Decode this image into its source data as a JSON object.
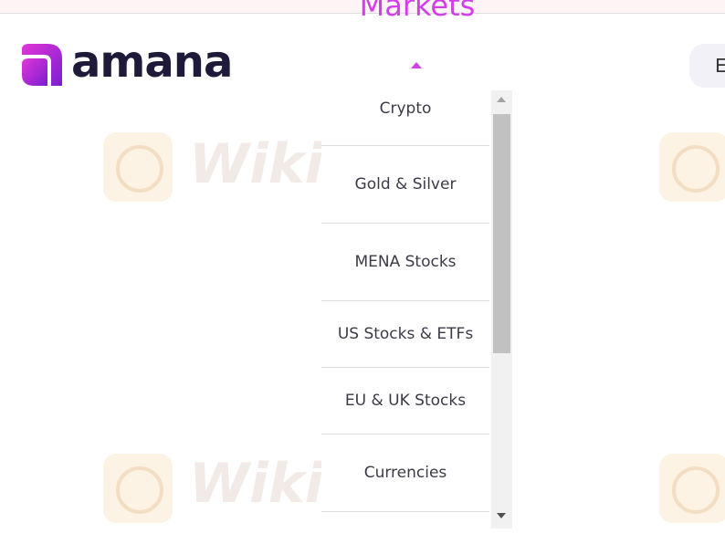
{
  "top_strip": {},
  "brand": {
    "name": "amana",
    "accent_color": "#d23fe8",
    "logo_gradient": [
      "#e235d8",
      "#7a1fd0"
    ],
    "text_color": "#1d1a3a"
  },
  "nav": {
    "active_title": "Markets"
  },
  "language": {
    "label": "E"
  },
  "markets_menu": {
    "items": [
      {
        "label": "Crypto"
      },
      {
        "label": "Gold & Silver"
      },
      {
        "label": "MENA Stocks"
      },
      {
        "label": "US Stocks & ETFs"
      },
      {
        "label": "EU & UK Stocks"
      },
      {
        "label": "Currencies"
      },
      {
        "label": ""
      }
    ]
  },
  "watermark": {
    "text": "WikiFX"
  }
}
